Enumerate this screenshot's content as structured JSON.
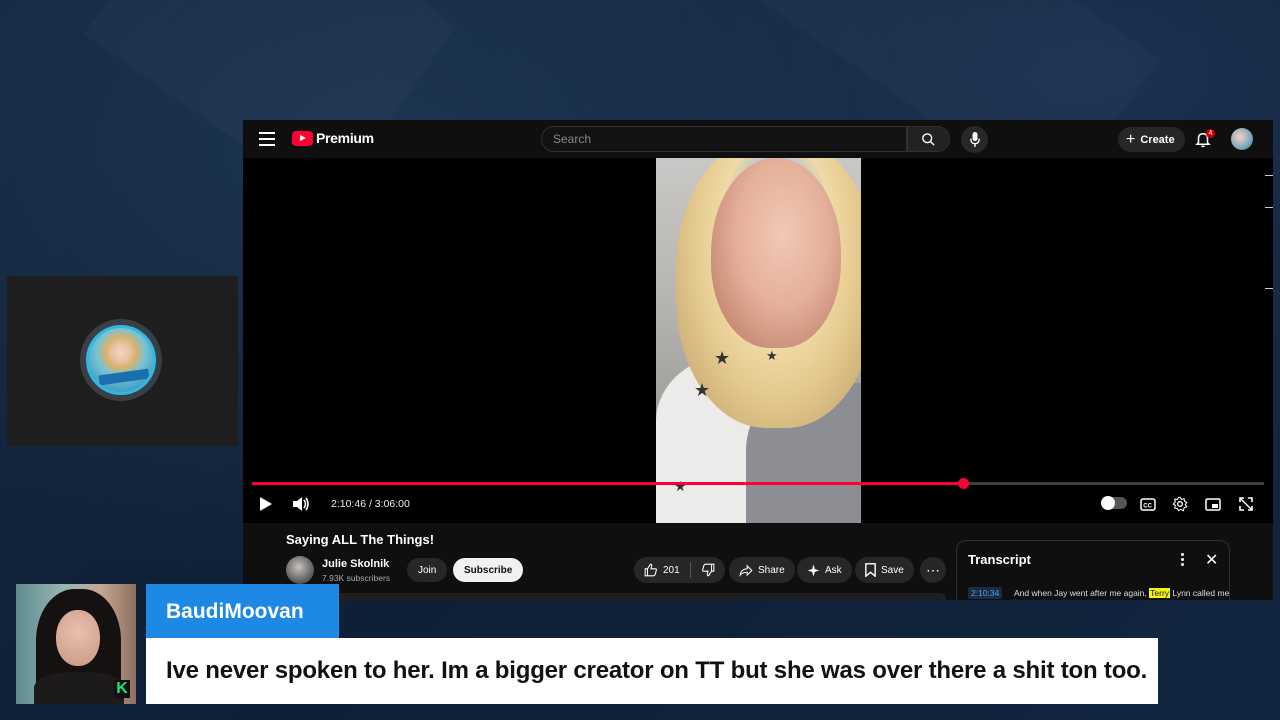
{
  "youtube": {
    "brand": "Premium",
    "search_placeholder": "Search",
    "create_label": "Create",
    "notification_count": "4"
  },
  "player": {
    "current_time": "2:10:46",
    "duration": "3:06:00",
    "time_display": "2:10:46 / 3:06:00",
    "progress_fraction": 0.7027,
    "accent_color": "#ff0033"
  },
  "video": {
    "title": "Saying ALL The Things!",
    "channel_name": "Julie Skolnik",
    "subscribers": "7.93K subscribers",
    "join_label": "Join",
    "subscribe_label": "Subscribe",
    "like_count": "201",
    "share_label": "Share",
    "ask_label": "Ask",
    "save_label": "Save"
  },
  "transcript": {
    "title": "Transcript",
    "timestamp": "2:10:34",
    "text_before": "And when Jay went after me again,",
    "highlight": "Terry",
    "text_after": "Lynn called me"
  },
  "overlay": {
    "username": "BaudiMoovan",
    "comment": "Ive never spoken to her. Im a bigger creator on TT but she was over there a shit ton too.",
    "name_box_color": "#1e88e5",
    "kick_logo": "K"
  }
}
